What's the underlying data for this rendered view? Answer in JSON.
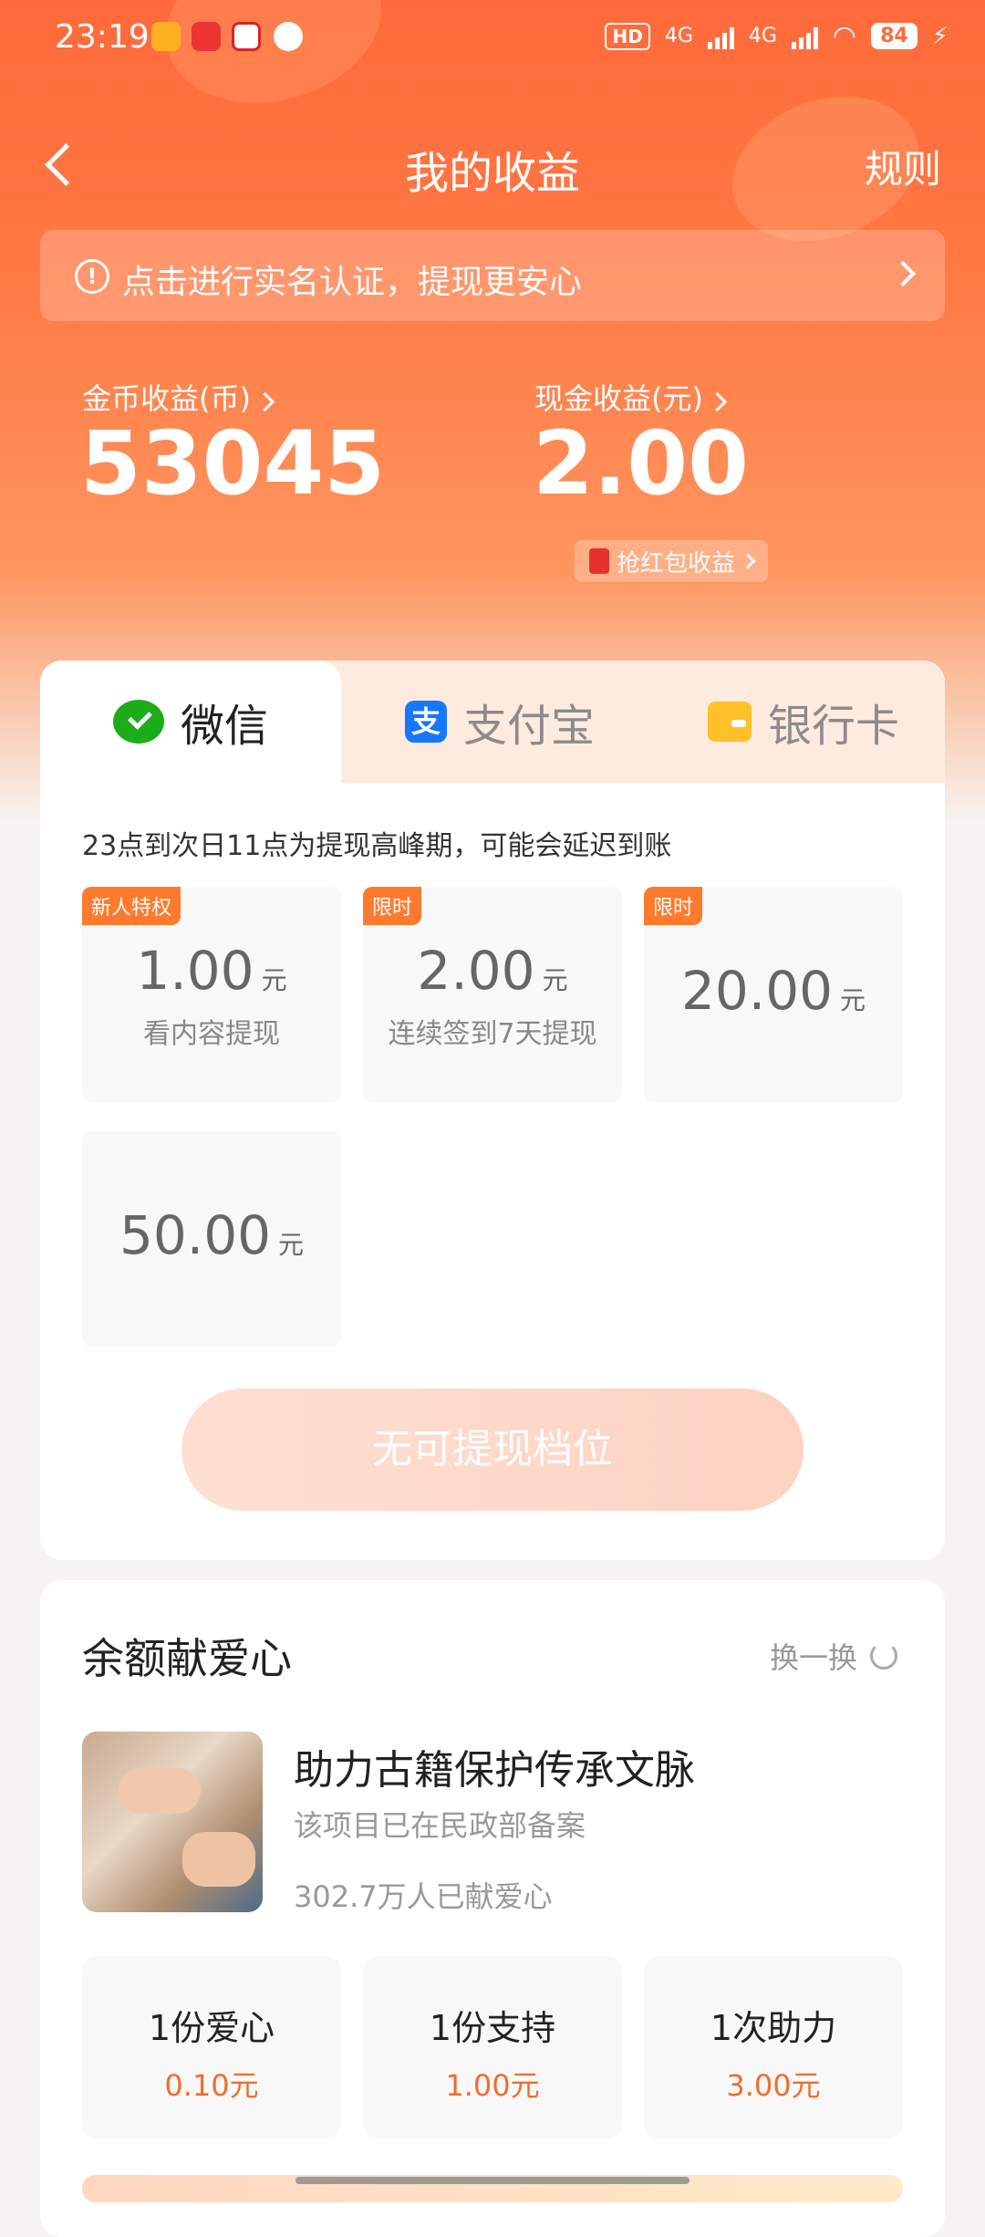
{
  "status_bar": {
    "time": "23:19",
    "network_badge": "HD",
    "net1": "4G",
    "net2": "4G",
    "battery": "84"
  },
  "header": {
    "title": "我的收益",
    "rules_label": "规则"
  },
  "verify_banner": {
    "text": "点击进行实名认证，提现更安心"
  },
  "earnings": {
    "coin_label": "金币收益(币)",
    "coin_value": "53045",
    "cash_label": "现金收益(元)",
    "cash_value": "2.00",
    "grab_label": "抢红包收益"
  },
  "payment_tabs": [
    {
      "label": "微信",
      "icon": "wechat-icon",
      "active": true
    },
    {
      "label": "支付宝",
      "icon": "alipay-icon",
      "active": false
    },
    {
      "label": "银行卡",
      "icon": "bank-card-icon",
      "active": false
    }
  ],
  "peak_notice": "23点到次日11点为提现高峰期，可能会延迟到账",
  "options": [
    {
      "tag": "新人特权",
      "amount": "1.00",
      "unit": "元",
      "desc": "看内容提现"
    },
    {
      "tag": "限时",
      "amount": "2.00",
      "unit": "元",
      "desc": "连续签到7天提现"
    },
    {
      "tag": "限时",
      "amount": "20.00",
      "unit": "元",
      "desc": ""
    },
    {
      "tag": "",
      "amount": "50.00",
      "unit": "元",
      "desc": ""
    }
  ],
  "withdraw_button": "无可提现档位",
  "charity": {
    "title": "余额献爱心",
    "refresh_label": "换一换",
    "project": {
      "title": "助力古籍保护传承文脉",
      "subtitle": "该项目已在民政部备案",
      "count": "302.7万人已献爱心"
    },
    "donations": [
      {
        "label": "1份爱心",
        "price": "0.10元"
      },
      {
        "label": "1份支持",
        "price": "1.00元"
      },
      {
        "label": "1次助力",
        "price": "3.00元"
      }
    ]
  },
  "colors": {
    "brand": "#ff6a3b",
    "accent_price": "#f36c2d",
    "tag": "#ff7a2e"
  }
}
